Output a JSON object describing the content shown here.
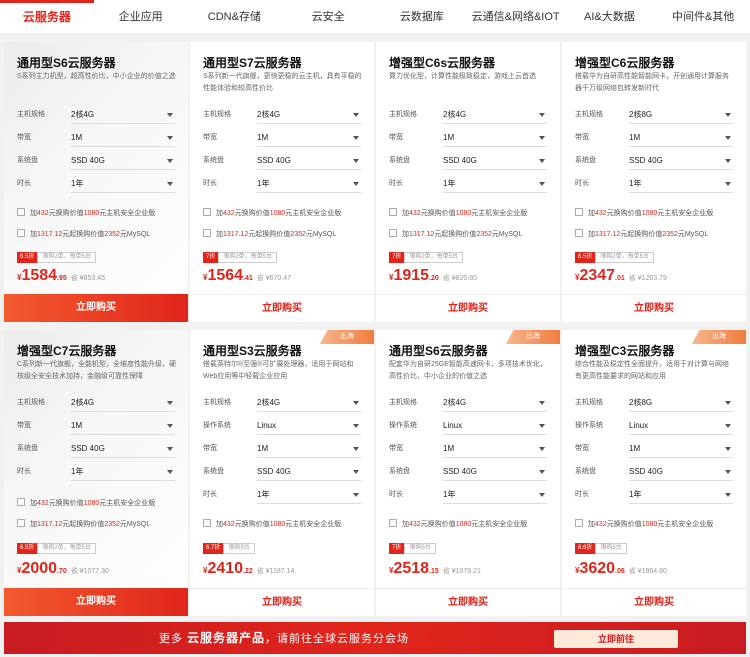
{
  "tabs": [
    "云服务器",
    "企业应用",
    "CDN&存储",
    "云安全",
    "云数据库",
    "云通信&网络&IOT",
    "AI&大数据",
    "中间件&其他"
  ],
  "labels": {
    "spec": "主机规格",
    "os": "操作系统",
    "bw": "带宽",
    "disk": "系统盘",
    "dur": "时长"
  },
  "buy_label": "立即购买",
  "sea_tag": "出海",
  "offers": {
    "security": {
      "pre": "加",
      "amt": "432",
      "mid": "元换购价值",
      "val": "1080",
      "post": "元主机安全企业版"
    },
    "mysql": {
      "pre": "加",
      "amt": "1317.12",
      "mid": "元起换购价值",
      "val": "2352",
      "post": "元MySQL"
    }
  },
  "cards": [
    {
      "title": "通用型S6云服务器",
      "desc": "S系列主力机型，超高性价比，中小企业的价值之选",
      "spec": "2核4G",
      "bw": "1M",
      "disk": "SSD 40G",
      "dur": "1年",
      "discount": "6.5折",
      "limit": "限购2单，每单5台",
      "price_int": "1584",
      "price_dec": ".95",
      "orig": "省 ¥853.45",
      "cur": "¥"
    },
    {
      "title": "通用型S7云服务器",
      "desc": "S系列新一代旗舰，更快更稳的云主机，具有平稳的性能体验和较高性价比",
      "spec": "2核4G",
      "bw": "1M",
      "disk": "SSD 40G",
      "dur": "1年",
      "discount": "7折",
      "limit": "限购2单，每单5台",
      "price_int": "1564",
      "price_dec": ".41",
      "orig": "省 ¥670.47",
      "cur": "¥"
    },
    {
      "title": "增强型C6s云服务器",
      "desc": "算力优化型，计算性能极致稳定，游戏上云首选",
      "spec": "2核4G",
      "bw": "1M",
      "disk": "SSD 40G",
      "dur": "1年",
      "discount": "7折",
      "limit": "限购2单，每单5台",
      "price_int": "1915",
      "price_dec": ".20",
      "orig": "省 ¥820.80",
      "cur": "¥"
    },
    {
      "title": "增强型C6云服务器",
      "desc": "搭载华为自研高性能智能网卡，开创通用计算服务器千万级网络包转发新时代",
      "spec": "2核8G",
      "bw": "1M",
      "disk": "SSD 40G",
      "dur": "1年",
      "discount": "6.5折",
      "limit": "限购2单，每单5台",
      "price_int": "2347",
      "price_dec": ".01",
      "orig": "省 ¥1263.79",
      "cur": "¥"
    },
    {
      "title": "增强型C7云服务器",
      "desc": "C系列新一代旗舰，全能机型，全维度性能升级，硬核级全安全技术加持，金融级可靠性保障",
      "spec": "2核4G",
      "bw": "1M",
      "disk": "SSD 40G",
      "dur": "1年",
      "discount": "6.5折",
      "limit": "限购2单，每单5台",
      "price_int": "2000",
      "price_dec": ".70",
      "orig": "省 ¥1077.30",
      "cur": "¥"
    },
    {
      "title": "通用型S3云服务器",
      "desc": "搭载英特尔®至强®可扩展处理器，适用于网站和Web应用等中轻载企业应用",
      "spec": "2核4G",
      "os": "Linux",
      "bw": "1M",
      "disk": "SSD 40G",
      "dur": "1年",
      "discount": "6.7折",
      "limit": "限购5台",
      "price_int": "2410",
      "price_dec": ".22",
      "orig": "省 ¥1187.14",
      "cur": "¥"
    },
    {
      "title": "通用型S6云服务器",
      "desc": "配套华为自研25GE智能高速网卡，多项技术优化，高性价比，中小企业的价值之选",
      "spec": "2核4G",
      "os": "Linux",
      "bw": "1M",
      "disk": "SSD 40G",
      "dur": "1年",
      "discount": "7折",
      "limit": "限购5台",
      "price_int": "2518",
      "price_dec": ".15",
      "orig": "省 ¥1079.21",
      "cur": "¥"
    },
    {
      "title": "增强型C3云服务器",
      "desc": "综合性能及稳定性全面提升，适用于对计算与网络有更高性能要求的网站和应用",
      "spec": "2核8G",
      "os": "Linux",
      "bw": "1M",
      "disk": "SSD 40G",
      "dur": "1年",
      "discount": "6.6折",
      "limit": "限购5台",
      "price_int": "3620",
      "price_dec": ".06",
      "orig": "省 ¥1864.80",
      "cur": "¥"
    }
  ],
  "banner": {
    "pre": "更多",
    "bold": "云服务器产品",
    "post": "，请前往全球云服务分会场",
    "button": "立即前往"
  }
}
